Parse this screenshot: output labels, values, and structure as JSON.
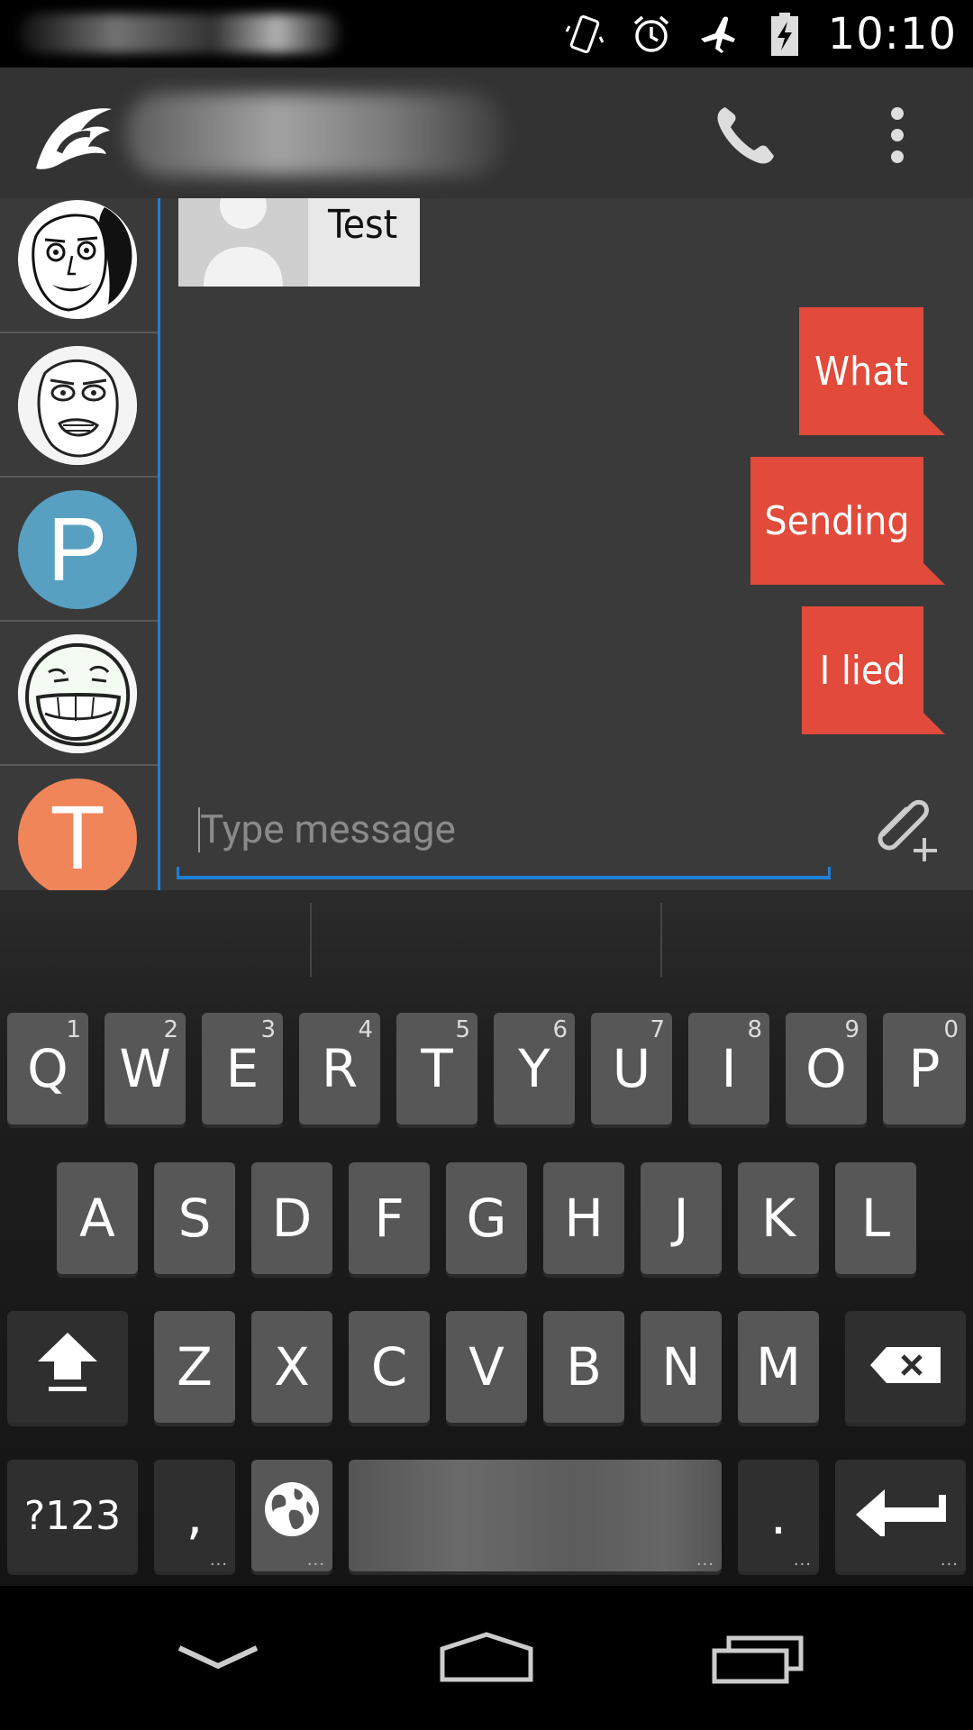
{
  "status_bar": {
    "time": "10:10",
    "icons": [
      "vibrate-icon",
      "alarm-icon",
      "airplane-mode-icon",
      "battery-charging-icon"
    ]
  },
  "action_bar": {
    "icons": [
      "app-logo-icon",
      "phone-icon",
      "overflow-menu-icon"
    ]
  },
  "contacts": [
    {
      "avatar": "meme-face-avatar"
    },
    {
      "avatar": "meme-face-avatar"
    },
    {
      "avatar": "letter-avatar",
      "letter": "P",
      "color": "#57a0c2"
    },
    {
      "avatar": "meme-face-avatar"
    },
    {
      "avatar": "letter-avatar",
      "letter": "T",
      "color": "#f0855a"
    }
  ],
  "messages": {
    "received": [
      {
        "text": "Test"
      }
    ],
    "sent": [
      {
        "text": "What"
      },
      {
        "text": "Sending"
      },
      {
        "text": "I lied"
      }
    ]
  },
  "composer": {
    "placeholder": "Type message",
    "attach_icon": "attach-add-icon"
  },
  "keyboard": {
    "row1": [
      {
        "label": "Q",
        "hint": "1"
      },
      {
        "label": "W",
        "hint": "2"
      },
      {
        "label": "E",
        "hint": "3"
      },
      {
        "label": "R",
        "hint": "4"
      },
      {
        "label": "T",
        "hint": "5"
      },
      {
        "label": "Y",
        "hint": "6"
      },
      {
        "label": "U",
        "hint": "7"
      },
      {
        "label": "I",
        "hint": "8"
      },
      {
        "label": "O",
        "hint": "9"
      },
      {
        "label": "P",
        "hint": "0"
      }
    ],
    "row2": [
      "A",
      "S",
      "D",
      "F",
      "G",
      "H",
      "J",
      "K",
      "L"
    ],
    "row3": [
      "Z",
      "X",
      "C",
      "V",
      "B",
      "N",
      "M"
    ],
    "symbols_label": "?123",
    "comma_label": ",",
    "period_label": ".",
    "more_indicator": "...",
    "icons": [
      "shift-icon",
      "backspace-icon",
      "globe-icon",
      "enter-icon"
    ]
  },
  "nav_bar": {
    "icons": [
      "back-icon",
      "home-icon",
      "recents-icon"
    ]
  },
  "colors": {
    "accent": "#1f7fd4",
    "sent_bubble": "#e24a3b",
    "chat_bg": "#3a3a3a",
    "action_bar_bg": "#333333"
  }
}
